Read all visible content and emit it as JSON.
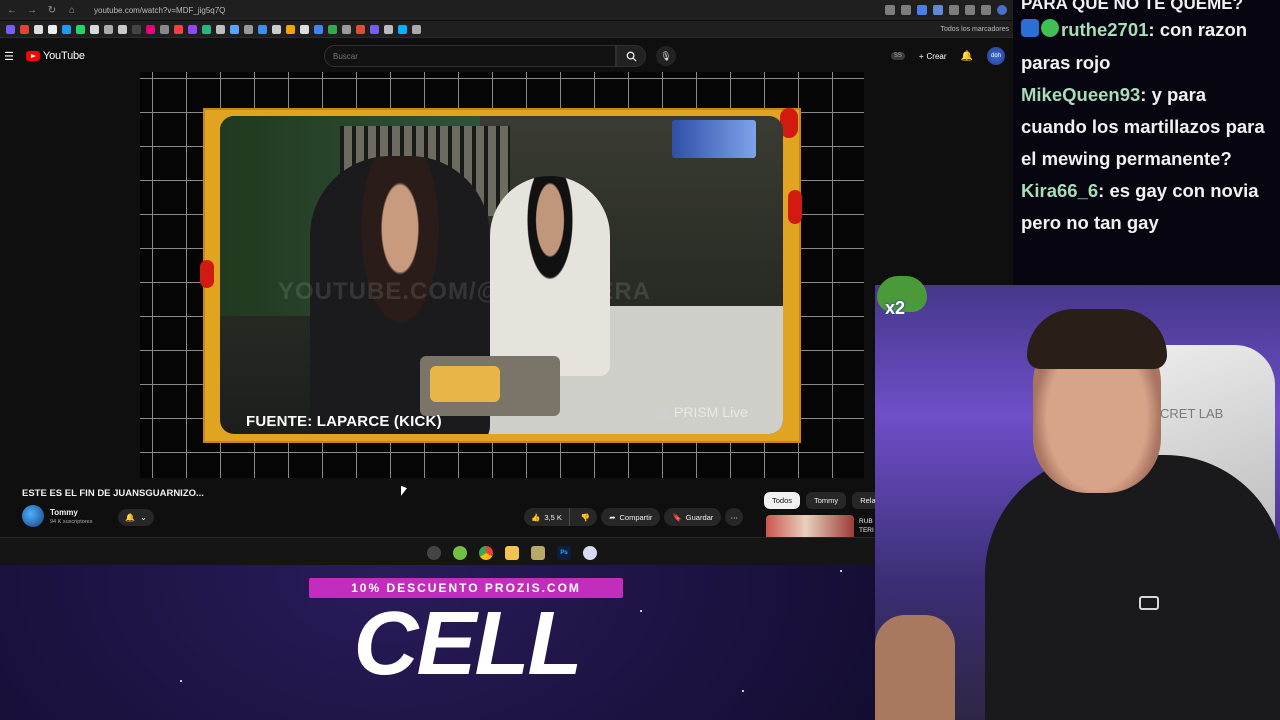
{
  "browser": {
    "url": "youtube.com/watch?v=MDF_jig5q7Q",
    "bookmarks_folder": "Todos los marcadores"
  },
  "youtube": {
    "logo_text": "YouTube",
    "search_placeholder": "Buscar",
    "subs_badge": "SS",
    "create_label": "Crear",
    "avatar_text": "doh"
  },
  "video": {
    "watermark": "YOUTUBE.COM/@AVQUIVERA",
    "source_label": "FUENTE: LAPARCE (KICK)",
    "prism_label": "PRISM Live",
    "title": "ESTE ES EL FIN DE JUANSGUARNIZO...",
    "channel_name": "Tommy",
    "channel_subs": "94 K suscriptores",
    "like_count": "3,5 K",
    "share_label": "Compartir",
    "save_label": "Guardar"
  },
  "chips": [
    "Todos",
    "Tommy",
    "Relacio"
  ],
  "related": {
    "text": "RUB TERI"
  },
  "chat": {
    "top_line": "PARA QUE NO TE QUEME?",
    "messages": [
      {
        "name": "ruthe2701",
        "text": ": con razon paras rojo"
      },
      {
        "name": "MikeQueen93",
        "text": ": y para cuando los martillazos para el mewing permanente?"
      },
      {
        "name": "Kira66_6",
        "text": ": es gay con novia pero no tan gay"
      }
    ]
  },
  "emote": {
    "multiplier": "x2"
  },
  "webcam": {
    "chair_text": "CRET LAB"
  },
  "sponsor": {
    "promo": "10% DESCUENTO PROZIS.COM",
    "code": "CELL"
  },
  "colors": {
    "accent_red": "#ff0000",
    "promo_magenta": "#c22dbd",
    "chat_name": "#a7ddb8"
  }
}
